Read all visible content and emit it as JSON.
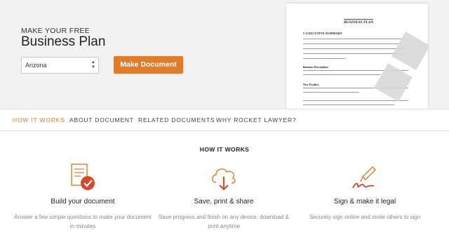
{
  "hero": {
    "eyebrow": "MAKE YOUR FREE",
    "title": "Business Plan",
    "state_select": {
      "value": "Arizona"
    },
    "make_button": "Make Document"
  },
  "preview": {
    "doc_title": "BUSINESS PLAN",
    "section": "I. EXECUTIVE SUMMARY",
    "lead_description": "Business Description.",
    "lead_new_product": "New Product.",
    "watermark_icon": "draft-watermark-icon"
  },
  "tabs": [
    {
      "label": "HOW IT WORKS",
      "active": true
    },
    {
      "label": "ABOUT DOCUMENT",
      "active": false
    },
    {
      "label": "RELATED DOCUMENTS",
      "active": false
    },
    {
      "label": "WHY ROCKET LAWYER?",
      "active": false
    }
  ],
  "how_it_works": {
    "title": "HOW IT WORKS",
    "features": [
      {
        "icon": "document-check-icon",
        "title": "Build your document",
        "desc": "Answer a few simple questions to make your document in minutes"
      },
      {
        "icon": "cloud-download-icon",
        "title": "Save, print & share",
        "desc": "Save progress and finish on any device, download & print anytime"
      },
      {
        "icon": "pen-signature-icon",
        "title": "Sign & make it legal",
        "desc": "Securely sign online and invite others to sign"
      }
    ]
  },
  "colors": {
    "accent": "#e07b2a",
    "hero_bg": "#f2f2f2"
  }
}
